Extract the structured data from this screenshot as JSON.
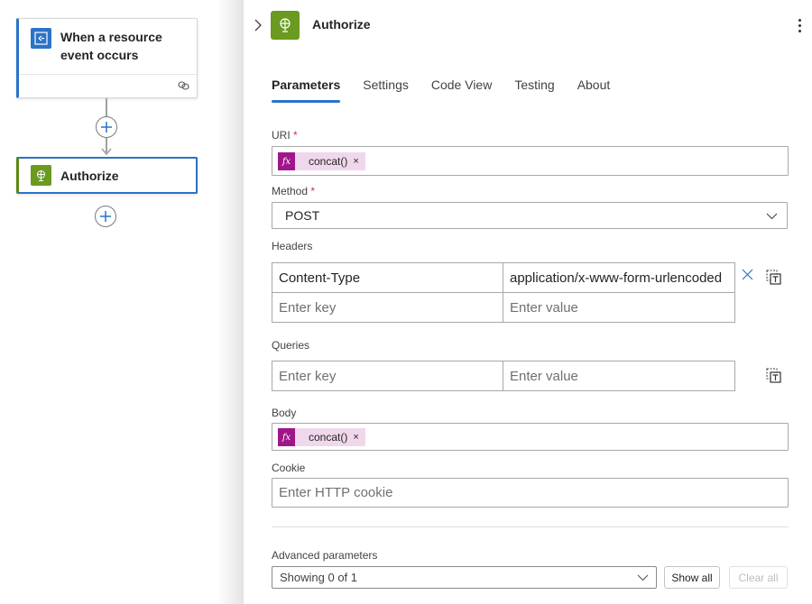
{
  "canvas": {
    "trigger_card": {
      "title_line1": "When a resource",
      "title_line2": "event occurs",
      "icon": "event-grid-icon",
      "icon_color": "#2b73c7",
      "footer_icon": "link-icon"
    },
    "action_card": {
      "title": "Authorize",
      "icon": "http-globe-icon",
      "icon_color": "#6a9a1f"
    },
    "add_step_icon": "plus-icon"
  },
  "panel": {
    "title": "Authorize",
    "icon": "http-globe-icon",
    "accent_color": "#2b73c7",
    "tabs": [
      {
        "label": "Parameters",
        "active": true
      },
      {
        "label": "Settings",
        "active": false
      },
      {
        "label": "Code View",
        "active": false
      },
      {
        "label": "Testing",
        "active": false
      },
      {
        "label": "About",
        "active": false
      }
    ],
    "uri": {
      "label": "URI",
      "required": "*",
      "token": {
        "icon": "fx",
        "text": "concat()",
        "remove": "×"
      }
    },
    "method": {
      "label": "Method",
      "required": "*",
      "value": "POST"
    },
    "headers": {
      "label": "Headers",
      "rows": [
        {
          "key": "Content-Type",
          "value": "application/x-www-form-urlencoded"
        }
      ],
      "key_placeholder": "Enter key",
      "value_placeholder": "Enter value"
    },
    "queries": {
      "label": "Queries",
      "key_placeholder": "Enter key",
      "value_placeholder": "Enter value"
    },
    "body": {
      "label": "Body",
      "token": {
        "icon": "fx",
        "text": "concat()",
        "remove": "×"
      }
    },
    "cookie": {
      "label": "Cookie",
      "placeholder": "Enter HTTP cookie"
    },
    "advanced": {
      "label": "Advanced parameters",
      "value": "Showing 0 of 1",
      "show_all": "Show all",
      "clear_all": "Clear all"
    }
  }
}
